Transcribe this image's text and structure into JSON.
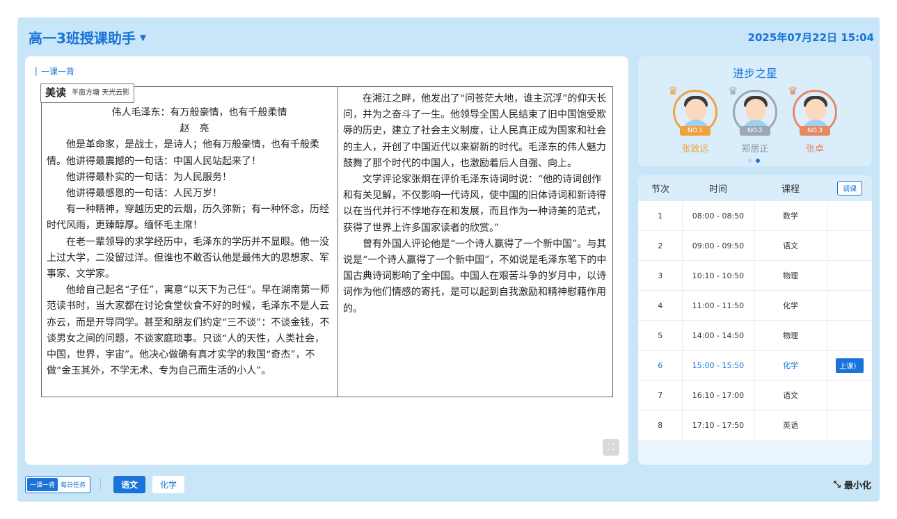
{
  "header": {
    "title": "高一3班授课助手",
    "datetime": "2025年07月22日 15:04"
  },
  "main": {
    "section_label": "一课一背",
    "badge": {
      "main": "美读",
      "sub": "半亩方塘 天光云影"
    },
    "left_column": {
      "title": "伟人毛泽东：有万般豪情，也有千般柔情",
      "author": "赵亮",
      "paragraphs": [
        "他是革命家，是战士，是诗人；他有万般豪情，也有千般柔情。他讲得最震撼的一句话：中国人民站起来了！",
        "他讲得最朴实的一句话：为人民服务！",
        "他讲得最感恩的一句话：人民万岁！",
        "有一种精神，穿越历史的云烟，历久弥新；有一种怀念，历经时代风雨，更臻醇厚。缅怀毛主席！",
        "在老一辈领导的求学经历中，毛泽东的学历并不显眼。他一没上过大学，二没留过洋。但谁也不敢否认他是最伟大的思想家、军事家、文学家。",
        "他给自己起名“子任”，寓意“以天下为己任”。早在湖南第一师范读书时，当大家都在讨论食堂伙食不好的时候，毛泽东不是人云亦云，而是开导同学。甚至和朋友们约定“三不谈”：不谈金钱，不谈男女之间的问题，不谈家庭琐事。只谈“人的天性，人类社会，中国，世界，宇宙”。他决心做确有真才实学的救国“奇杰”，不做“金玉其外，不学无术、专为自己而生活的小人”。"
      ]
    },
    "right_column": {
      "paragraphs": [
        "在湘江之畔，他发出了“问苍茫大地，谁主沉浮”的仰天长问，并为之奋斗了一生。他领导全国人民结束了旧中国饱受欺辱的历史，建立了社会主义制度，让人民真正成为国家和社会的主人，开创了中国近代以来崭新的时代。毛泽东的伟人魅力鼓舞了那个时代的中国人，也激励着后人自强、向上。",
        "文学评论家张炯在评价毛泽东诗词时说：“他的诗词创作和有关见解，不仅影响一代诗风，使中国的旧体诗词和新诗得以在当代并行不悖地存在和发展，而且作为一种诗美的范式，获得了世界上许多国家读者的欣赏。”",
        "曾有外国人评论他是“一个诗人赢得了一个新中国”。与其说是“一个诗人赢得了一个新中国”，不如说是毛泽东笔下的中国古典诗词影响了全中国。中国人在艰苦斗争的岁月中，以诗词作为他们情感的寄托，是可以起到自我激励和精神慰藉作用的。"
      ]
    }
  },
  "stars": {
    "title": "进步之星",
    "items": [
      {
        "rank": "NO.1",
        "name": "张致远",
        "color": "#f0a23f",
        "name_color": "#f0a23f"
      },
      {
        "rank": "NO.2",
        "name": "郑居正",
        "color": "#9aa7b5",
        "name_color": "#8c96a1"
      },
      {
        "rank": "NO.3",
        "name": "张卓",
        "color": "#e48a63",
        "name_color": "#e48a63"
      }
    ]
  },
  "schedule": {
    "headers": [
      "节次",
      "时间",
      "课程"
    ],
    "adjust_label": "调课",
    "start_label": "上课",
    "rows": [
      {
        "period": "1",
        "time": "08:00 - 08:50",
        "course": "数学"
      },
      {
        "period": "2",
        "time": "09:00 - 09:50",
        "course": "语文"
      },
      {
        "period": "3",
        "time": "10:10 - 10:50",
        "course": "物理"
      },
      {
        "period": "4",
        "time": "11:00 - 11:50",
        "course": "化学"
      },
      {
        "period": "5",
        "time": "14:00 - 14:50",
        "course": "物理"
      },
      {
        "period": "6",
        "time": "15:00 - 15:50",
        "course": "化学"
      },
      {
        "period": "7",
        "time": "16:10 - 17:00",
        "course": "语文"
      },
      {
        "period": "8",
        "time": "17:10 - 17:50",
        "course": "英语"
      }
    ]
  },
  "footer": {
    "tab_a": "一课一背",
    "tab_b": "每日任务",
    "subjects": [
      "语文",
      "化学"
    ],
    "minimize_label": "最小化"
  },
  "icons": {
    "dropdown": "caret-down-icon",
    "expand": "fullscreen-icon",
    "minimize": "minimize-icon"
  },
  "colors": {
    "accent": "#1a73d9",
    "panel": "#c9e6f8"
  }
}
